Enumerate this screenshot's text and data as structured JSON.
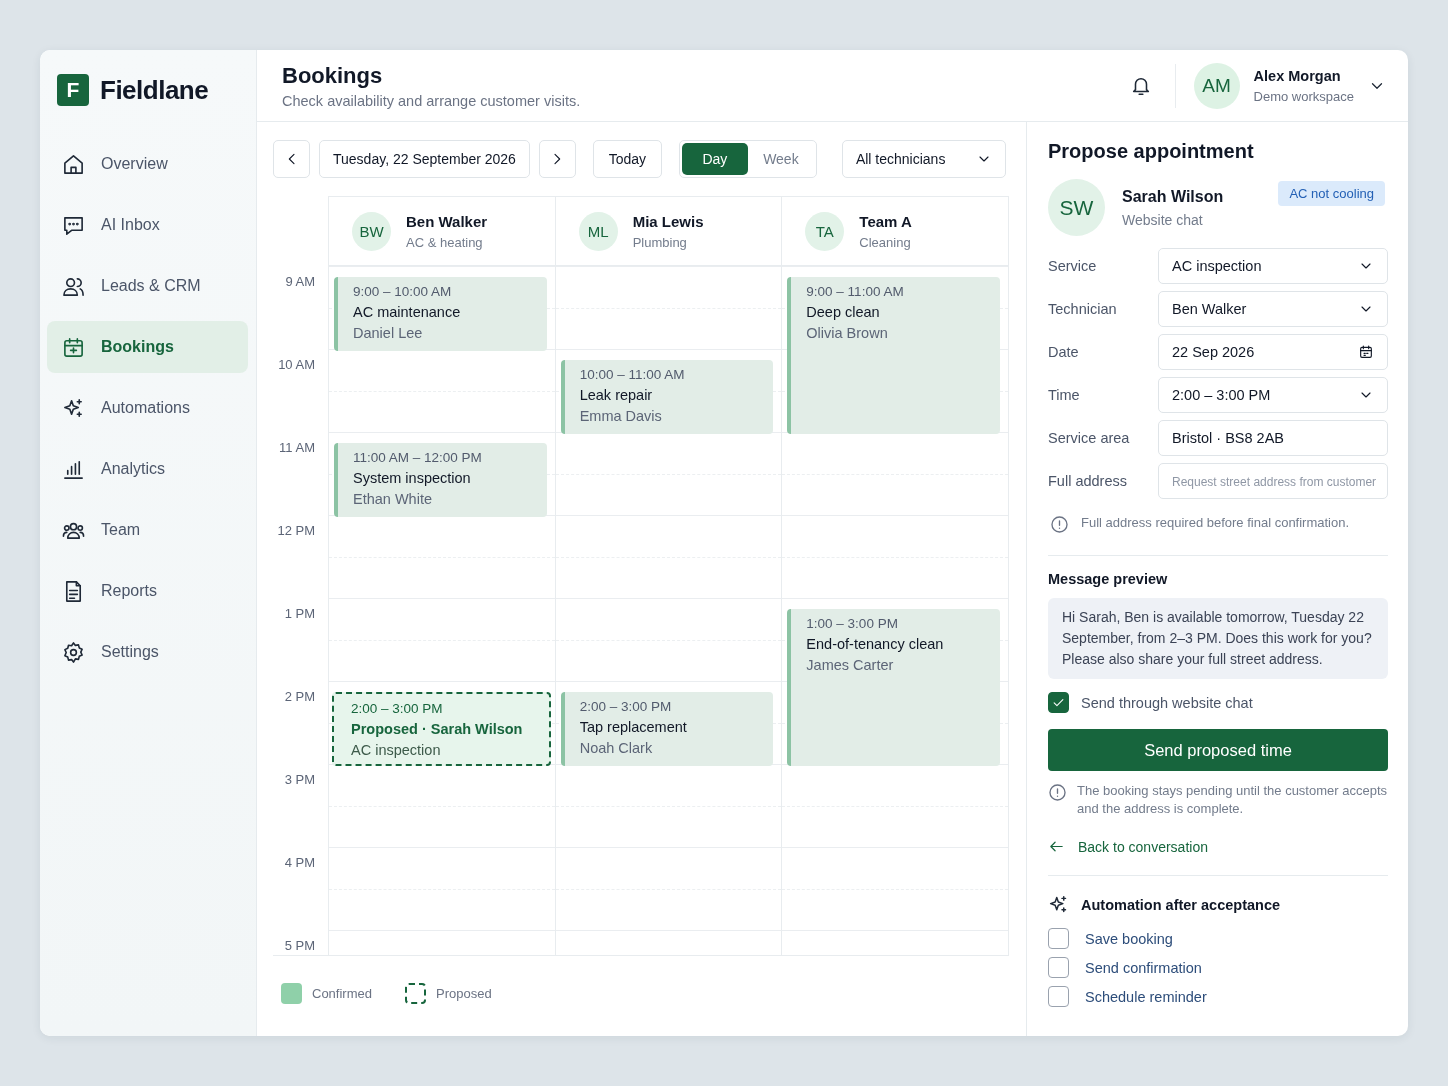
{
  "brand": {
    "logo_letter": "F",
    "name": "Fieldlane"
  },
  "sidebar": {
    "items": [
      {
        "label": "Overview",
        "selected": false
      },
      {
        "label": "AI Inbox",
        "selected": false
      },
      {
        "label": "Leads & CRM",
        "selected": false
      },
      {
        "label": "Bookings",
        "selected": true
      },
      {
        "label": "Automations",
        "selected": false
      },
      {
        "label": "Analytics",
        "selected": false
      },
      {
        "label": "Team",
        "selected": false
      },
      {
        "label": "Reports",
        "selected": false
      },
      {
        "label": "Settings",
        "selected": false
      }
    ]
  },
  "header": {
    "title": "Bookings",
    "subtitle": "Check availability and arrange customer visits.",
    "user": {
      "initials": "AM",
      "name": "Alex Morgan",
      "workspace": "Demo workspace"
    }
  },
  "toolbar": {
    "date": "Tuesday, 22 September 2026",
    "today": "Today",
    "views": [
      {
        "label": "Day",
        "selected": true
      },
      {
        "label": "Week",
        "selected": false
      }
    ],
    "filter": "All technicians"
  },
  "calendar": {
    "hours": [
      "9 AM",
      "10 AM",
      "11 AM",
      "12 PM",
      "1 PM",
      "2 PM",
      "3 PM",
      "4 PM",
      "5 PM"
    ],
    "columns": [
      {
        "initials": "BW",
        "name": "Ben Walker",
        "role": "AC & heating",
        "events": [
          {
            "kind": "confirmed",
            "time": "9:00 – 10:00 AM",
            "title": "AC maintenance",
            "customer": "Daniel Lee"
          },
          {
            "kind": "confirmed",
            "time": "11:00 AM – 12:00 PM",
            "title": "System inspection",
            "customer": "Ethan White"
          },
          {
            "kind": "proposed",
            "time": "2:00 – 3:00 PM",
            "title": "Proposed · Sarah Wilson",
            "customer": "AC inspection"
          }
        ]
      },
      {
        "initials": "ML",
        "name": "Mia Lewis",
        "role": "Plumbing",
        "events": [
          {
            "kind": "confirmed",
            "time": "10:00 – 11:00 AM",
            "title": "Leak repair",
            "customer": "Emma Davis"
          },
          {
            "kind": "confirmed",
            "time": "2:00 – 3:00 PM",
            "title": "Tap replacement",
            "customer": "Noah Clark"
          }
        ]
      },
      {
        "initials": "TA",
        "name": "Team A",
        "role": "Cleaning",
        "events": [
          {
            "kind": "confirmed",
            "time": "9:00 – 11:00 AM",
            "title": "Deep clean",
            "customer": "Olivia Brown"
          },
          {
            "kind": "confirmed",
            "time": "1:00 – 3:00 PM",
            "title": "End-of-tenancy clean",
            "customer": "James Carter"
          }
        ]
      }
    ],
    "legend": [
      {
        "kind": "confirmed",
        "label": "Confirmed"
      },
      {
        "kind": "proposed",
        "label": "Proposed"
      }
    ]
  },
  "panel": {
    "title": "Propose appointment",
    "customer": {
      "initials": "SW",
      "name": "Sarah Wilson",
      "source": "Website chat",
      "tag": "AC not cooling"
    },
    "fields": [
      {
        "kind": "select",
        "label": "Service",
        "value": "AC inspection"
      },
      {
        "kind": "select",
        "label": "Technician",
        "value": "Ben Walker"
      },
      {
        "kind": "date",
        "label": "Date",
        "value": "22 Sep 2026"
      },
      {
        "kind": "select",
        "label": "Time",
        "value": "2:00 – 3:00 PM"
      },
      {
        "kind": "text",
        "label": "Service area",
        "value": "Bristol · BS8 2AB"
      },
      {
        "kind": "text",
        "label": "Full address",
        "placeholder": "Request street address from customer"
      }
    ],
    "address_note": "Full address required before final confirmation.",
    "message_title": "Message preview",
    "message": "Hi Sarah, Ben is available tomorrow, Tuesday 22 September, from 2–3 PM. Does this work for you? Please also share your full street address.",
    "send_via": {
      "label": "Send through website chat",
      "checked": true
    },
    "send_button": "Send proposed time",
    "pending_note": "The booking stays pending until the customer accepts and the address is complete.",
    "back_link": "Back to conversation",
    "automation_title": "Automation after acceptance",
    "automations": [
      {
        "label": "Save booking",
        "checked": false
      },
      {
        "label": "Send confirmation",
        "checked": false
      },
      {
        "label": "Schedule reminder",
        "checked": false
      }
    ]
  }
}
